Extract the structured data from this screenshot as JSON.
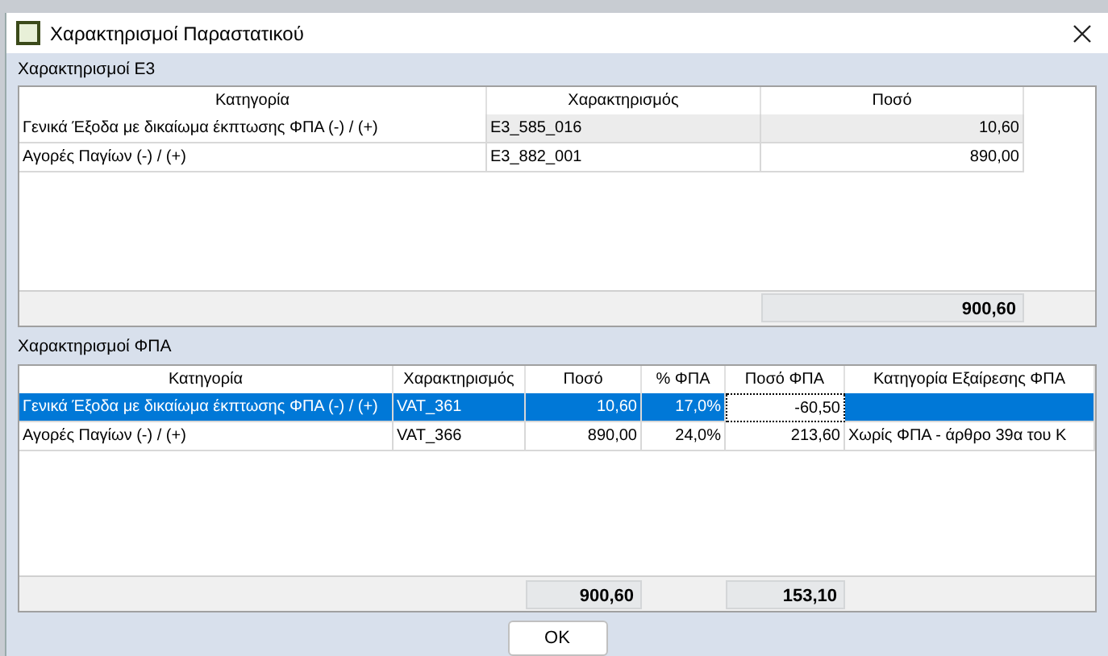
{
  "window": {
    "title": "Χαρακτηρισμοί Παραστατικού"
  },
  "e3": {
    "title": "Χαρακτηρισμοί Ε3",
    "columns": [
      {
        "label": "Κατηγορία"
      },
      {
        "label": "Χαρακτηρισμός"
      },
      {
        "label": "Ποσό",
        "total": "900,60"
      }
    ],
    "rows": [
      {
        "selected": true,
        "cells": [
          "Γενικά Έξοδα με δικαίωμα έκπτωσης ΦΠΑ (-) / (+)",
          "E3_585_016",
          "10,60"
        ]
      },
      {
        "selected": false,
        "cells": [
          "Αγορές Παγίων (-) / (+)",
          "E3_882_001",
          "890,00"
        ]
      }
    ]
  },
  "vat": {
    "title": "Χαρακτηρισμοί ΦΠΑ",
    "columns": [
      {
        "label": "Κατηγορία"
      },
      {
        "label": "Χαρακτηρισμός"
      },
      {
        "label": "Ποσό",
        "total": "900,60"
      },
      {
        "label": "% ΦΠΑ"
      },
      {
        "label": "Ποσό ΦΠΑ",
        "total": "153,10"
      },
      {
        "label": "Κατηγορία Εξαίρεσης ΦΠΑ"
      }
    ],
    "rows": [
      {
        "selected": true,
        "cells": [
          {
            "text": "Γενικά Έξοδα με δικαίωμα έκπτωσης ΦΠΑ (-) / (+)",
            "focused": false
          },
          {
            "text": "VAT_361",
            "focused": false
          },
          {
            "text": "10,60",
            "focused": false
          },
          {
            "text": "17,0%",
            "focused": false
          },
          {
            "text": "-60,50",
            "focused": true
          },
          {
            "text": "",
            "focused": false
          }
        ]
      },
      {
        "selected": false,
        "cells": [
          {
            "text": "Αγορές Παγίων (-) / (+)",
            "focused": false
          },
          {
            "text": "VAT_366",
            "focused": false
          },
          {
            "text": "890,00",
            "focused": false
          },
          {
            "text": "24,0%",
            "focused": false
          },
          {
            "text": "213,60",
            "focused": false
          },
          {
            "text": "Χωρίς ΦΠΑ - άρθρο 39α του Κ",
            "focused": false
          }
        ]
      }
    ]
  },
  "buttons": [
    "OK"
  ]
}
